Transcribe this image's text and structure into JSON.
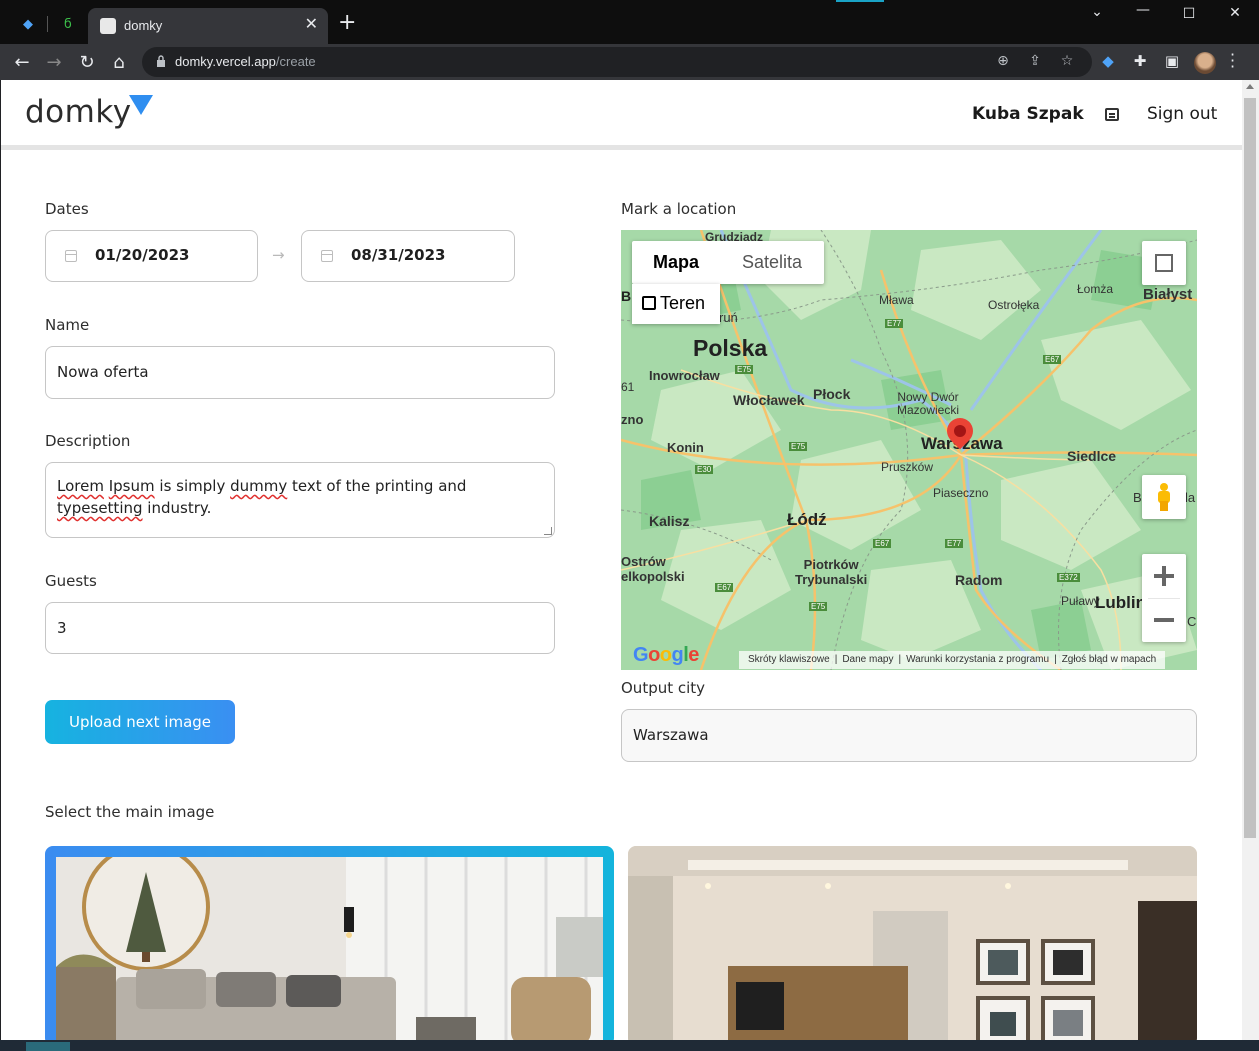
{
  "browser": {
    "tab_title": "domky",
    "url_host": "domky.vercel.app",
    "url_path": "/create"
  },
  "header": {
    "logo": "domky",
    "user_name": "Kuba Szpak",
    "sign_out": "Sign out"
  },
  "form": {
    "dates_label": "Dates",
    "start_date": "01/20/2023",
    "end_date": "08/31/2023",
    "name_label": "Name",
    "name_value": "Nowa oferta",
    "description_label": "Description",
    "description_parts": {
      "p1": "Lorem",
      "p2": "Ipsum",
      "p3": "is simply",
      "p4": "dummy",
      "p5": "text of the printing and",
      "p6": "typesetting",
      "p7": "industry."
    },
    "guests_label": "Guests",
    "guests_value": "3",
    "upload_button": "Upload next image"
  },
  "map": {
    "label": "Mark a location",
    "type_map": "Mapa",
    "type_satellite": "Satelita",
    "terrain": "Teren",
    "google": "Google",
    "attribution": [
      "Skróty klawiszowe",
      "Dane mapy",
      "Warunki korzystania z programu",
      "Zgłoś błąd w mapach"
    ],
    "places": {
      "grudziadz": "Grudziądz",
      "torun": "ruń",
      "mlawa": "Mława",
      "ostroleka": "Ostrołęka",
      "lomza": "Łomża",
      "bialystok": "Białyst",
      "polska": "Polska",
      "inowroclaw": "Inowrocław",
      "wloclawek": "Włocławek",
      "plock": "Płock",
      "nowy_dwor": "Nowy Dwór",
      "mazowiecki": "Mazowiecki",
      "konin": "Konin",
      "warszawa": "Warszawa",
      "siedlce": "Siedlce",
      "pruszkow": "Pruszków",
      "piaseczno": "Piaseczno",
      "kalisz": "Kalisz",
      "lodz": "Łódź",
      "ostrow": "Ostrów",
      "wielkopolski": "elkopolski",
      "piotrkow": "Piotrków",
      "trybunalski": "Trybunalski",
      "radom": "Radom",
      "pulawy": "Puławy",
      "lublin": "Lublin",
      "gniezno": "zno",
      "e61": "61",
      "b": "B",
      "la": "la",
      "c": "C"
    },
    "roads": [
      "E77",
      "E75",
      "E67",
      "E30",
      "E75",
      "E67",
      "E77",
      "E67",
      "E75",
      "E372"
    ]
  },
  "output": {
    "label": "Output city",
    "value": "Warszawa"
  },
  "images": {
    "label": "Select the main image"
  },
  "colors": {
    "accent_start": "#16b3e0",
    "accent_end": "#3a8ff2",
    "logo_triangle": "#2f8ef0",
    "map_green": "#a6d9a8",
    "pin": "#ea4335"
  }
}
